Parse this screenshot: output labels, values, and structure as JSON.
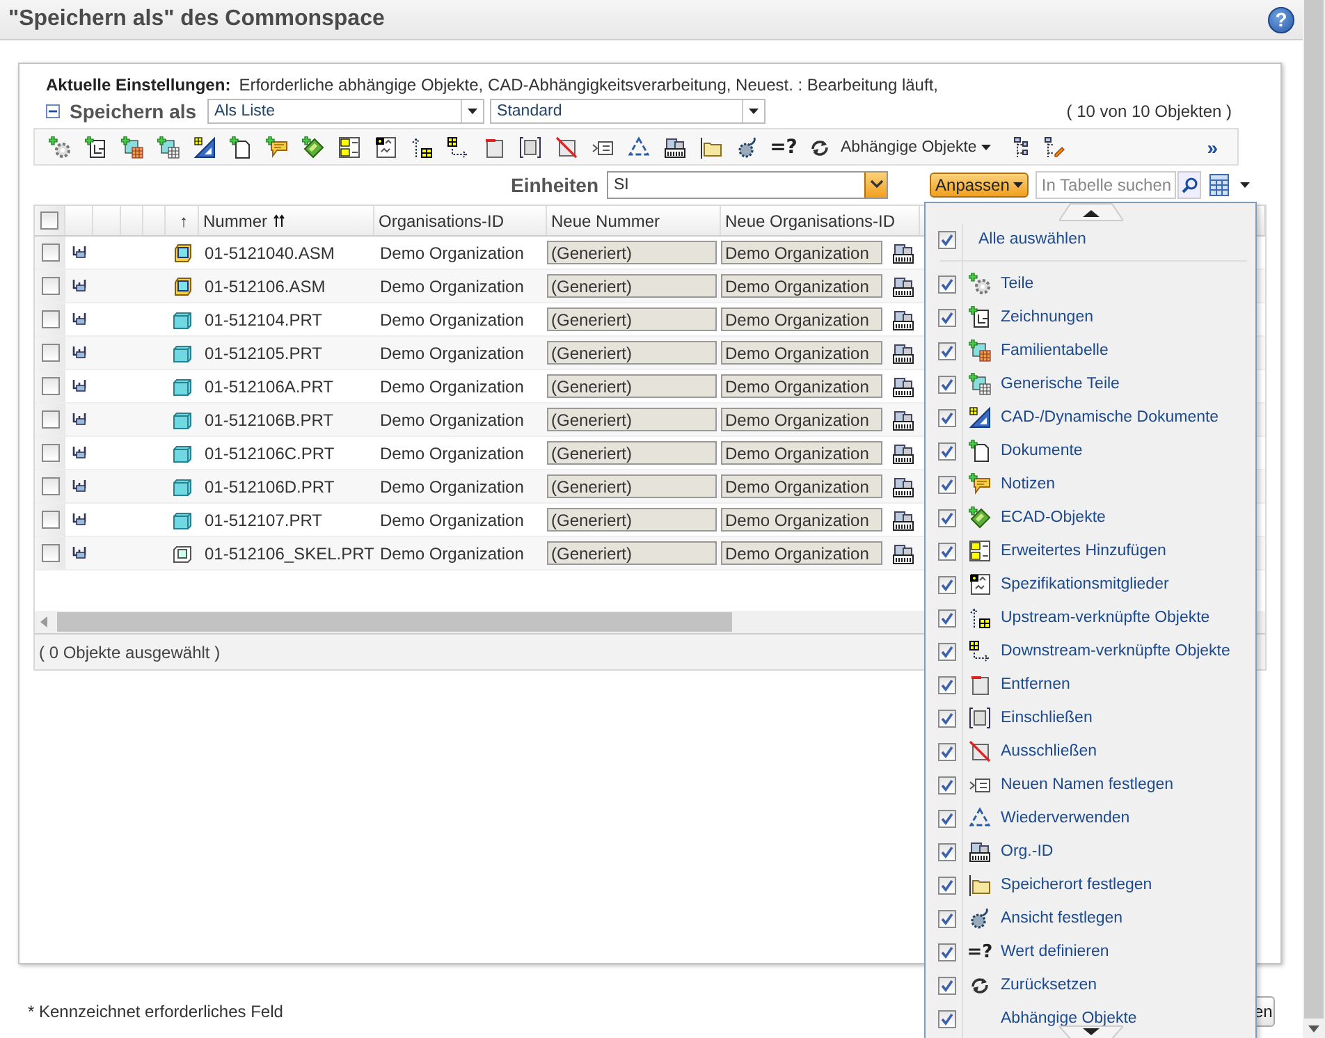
{
  "header": {
    "title": "\"Speichern als\" des Commonspace",
    "help": "?"
  },
  "settings": {
    "label": "Aktuelle Einstellungen:",
    "value": "Erforderliche abhängige Objekte, CAD-Abhängigkeitsverarbeitung, Neuest. : Bearbeitung läuft,"
  },
  "save_as": {
    "expanded": true,
    "label": "Speichern als",
    "view": "Als Liste",
    "layout": "Standard",
    "count": "( 10 von 10 Objekten )"
  },
  "toolbar": {
    "items": [
      {
        "kind": "icon"
      },
      {
        "kind": "icon"
      },
      {
        "kind": "icon"
      },
      {
        "kind": "icon"
      },
      {
        "kind": "icon"
      },
      {
        "kind": "icon"
      },
      {
        "kind": "icon"
      },
      {
        "kind": "icon"
      },
      {
        "kind": "icon"
      },
      {
        "kind": "icon"
      },
      {
        "kind": "icon"
      },
      {
        "kind": "icon"
      },
      {
        "kind": "icon"
      },
      {
        "kind": "icon"
      },
      {
        "kind": "icon"
      },
      {
        "kind": "icon"
      },
      {
        "kind": "icon"
      },
      {
        "kind": "icon"
      },
      {
        "kind": "icon"
      },
      {
        "kind": "icon"
      },
      {
        "kind": "glyph",
        "text": "=?"
      },
      {
        "kind": "icon"
      },
      {
        "kind": "menu",
        "label": "Abhängige Objekte"
      },
      {
        "kind": "icon"
      },
      {
        "kind": "icon"
      }
    ],
    "more": "»"
  },
  "units": {
    "label": "Einheiten",
    "value": "SI"
  },
  "customize": {
    "label": "Anpassen",
    "search_placeholder": "In Tabelle suchen"
  },
  "table": {
    "all_checked": false,
    "sort_mark": "↑",
    "columns": [
      "Nummer",
      "Organisations-ID",
      "Neue Nummer",
      "Neue Organisations-ID"
    ],
    "rows": [
      {
        "checked": false,
        "kind": "assembly",
        "number": "01-5121040.ASM",
        "org": "Demo Organization",
        "new_number": "(Generiert)",
        "new_org": "Demo Organization"
      },
      {
        "checked": false,
        "kind": "assembly",
        "number": "01-512106.ASM",
        "org": "Demo Organization",
        "new_number": "(Generiert)",
        "new_org": "Demo Organization"
      },
      {
        "checked": false,
        "kind": "part",
        "number": "01-512104.PRT",
        "org": "Demo Organization",
        "new_number": "(Generiert)",
        "new_org": "Demo Organization"
      },
      {
        "checked": false,
        "kind": "part",
        "number": "01-512105.PRT",
        "org": "Demo Organization",
        "new_number": "(Generiert)",
        "new_org": "Demo Organization"
      },
      {
        "checked": false,
        "kind": "part",
        "number": "01-512106A.PRT",
        "org": "Demo Organization",
        "new_number": "(Generiert)",
        "new_org": "Demo Organization"
      },
      {
        "checked": false,
        "kind": "part",
        "number": "01-512106B.PRT",
        "org": "Demo Organization",
        "new_number": "(Generiert)",
        "new_org": "Demo Organization"
      },
      {
        "checked": false,
        "kind": "part",
        "number": "01-512106C.PRT",
        "org": "Demo Organization",
        "new_number": "(Generiert)",
        "new_org": "Demo Organization"
      },
      {
        "checked": false,
        "kind": "part",
        "number": "01-512106D.PRT",
        "org": "Demo Organization",
        "new_number": "(Generiert)",
        "new_org": "Demo Organization"
      },
      {
        "checked": false,
        "kind": "part",
        "number": "01-512107.PRT",
        "org": "Demo Organization",
        "new_number": "(Generiert)",
        "new_org": "Demo Organization"
      },
      {
        "checked": false,
        "kind": "skeleton",
        "number": "01-512106_SKEL.PRT",
        "org": "Demo Organization",
        "new_number": "(Generiert)",
        "new_org": "Demo Organization"
      }
    ]
  },
  "status": "( 0 Objekte ausgewählt )",
  "menu": {
    "select_all": {
      "label": "Alle auswählen",
      "checked": true
    },
    "items": [
      {
        "kind": "icon",
        "label": "Teile",
        "checked": true
      },
      {
        "kind": "icon",
        "label": "Zeichnungen",
        "checked": true
      },
      {
        "kind": "icon",
        "label": "Familientabelle",
        "checked": true
      },
      {
        "kind": "icon",
        "label": "Generische Teile",
        "checked": true
      },
      {
        "kind": "icon",
        "label": "CAD-/Dynamische Dokumente",
        "checked": true
      },
      {
        "kind": "icon",
        "label": "Dokumente",
        "checked": true
      },
      {
        "kind": "icon",
        "label": "Notizen",
        "checked": true
      },
      {
        "kind": "icon",
        "label": "ECAD-Objekte",
        "checked": true
      },
      {
        "kind": "icon",
        "label": "Erweitertes Hinzufügen",
        "checked": true
      },
      {
        "kind": "icon",
        "label": "Spezifikationsmitglieder",
        "checked": true
      },
      {
        "kind": "icon",
        "label": "Upstream-verknüpfte Objekte",
        "checked": true
      },
      {
        "kind": "icon",
        "label": "Downstream-verknüpfte Objekte",
        "checked": true
      },
      {
        "kind": "icon",
        "label": "Entfernen",
        "checked": true
      },
      {
        "kind": "icon",
        "label": "Einschließen",
        "checked": true
      },
      {
        "kind": "icon",
        "label": "Ausschließen",
        "checked": true
      },
      {
        "kind": "icon",
        "label": "Neuen Namen festlegen",
        "checked": true
      },
      {
        "kind": "icon",
        "label": "Wiederverwenden",
        "checked": true
      },
      {
        "kind": "icon",
        "label": "Org.-ID",
        "checked": true
      },
      {
        "kind": "icon",
        "label": "Speicherort festlegen",
        "checked": true
      },
      {
        "kind": "icon",
        "label": "Ansicht festlegen",
        "checked": true
      },
      {
        "kind": "glyph",
        "glyph": "=?",
        "label": "Wert definieren",
        "checked": true
      },
      {
        "kind": "icon",
        "label": "Zurücksetzen",
        "checked": true
      },
      {
        "kind": "plain",
        "label": "Abhängige Objekte",
        "checked": true
      }
    ]
  },
  "footer": {
    "note": "* Kennzeichnet erforderliches Feld",
    "button": "en"
  }
}
